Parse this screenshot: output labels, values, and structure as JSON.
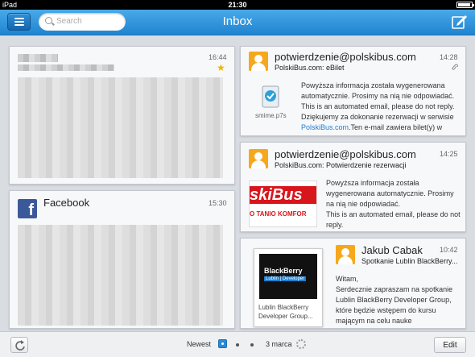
{
  "status_bar": {
    "device": "iPad",
    "time": "21:30"
  },
  "header": {
    "title": "Inbox",
    "search_placeholder": "Search"
  },
  "emails_left": [
    {
      "sender": "",
      "time": "16:44",
      "starred": true
    },
    {
      "sender": "Facebook",
      "time": "15:30"
    }
  ],
  "emails_right": [
    {
      "sender": "potwierdzenie@polskibus.com",
      "subject": "PolskiBus.com: eBilet",
      "time": "14:28",
      "attachment_name": "smime.p7s",
      "body_lines": [
        "Powyższa informacja została wygenerowana",
        "automatycznie. Prosimy na nią nie odpowiadać.",
        "This is an automated email, please do not reply.",
        "Dziękujemy za dokonanie rezerwacji w serwisie"
      ],
      "body_link": "PolskiBus.com",
      "body_tail": ".Ten e-mail zawiera bilet(y) w"
    },
    {
      "sender": "potwierdzenie@polskibus.com",
      "subject": "PolskiBus.com: Potwierdzenie rezerwacji",
      "time": "14:25",
      "logo_text": "skiBus",
      "logo_tagline": "O TANIO KOMFOR",
      "body_lines": [
        "Powyższa informacja została",
        "wygenerowana  automatycznie. Prosimy",
        "na nią nie odpowiadać.",
        "This is an automated email, please do not",
        "reply."
      ]
    },
    {
      "sender": "Jakub Cabak",
      "subject": "Spotkanie Lublin BlackBerry...",
      "time": "10:42",
      "attachment_logo": "BlackBerry",
      "attachment_logo_sub": "Lublin | Developer",
      "attachment_caption_1": "Lublin BlackBerry",
      "attachment_caption_2": "Developer Group...",
      "body_lines": [
        "Witam,",
        "Serdecznie zapraszam na spotkanie",
        "Lublin BlackBerry Developer Group,",
        "które będzie wstępem do kursu",
        "mającym na celu nauke"
      ]
    }
  ],
  "bottom_bar": {
    "newest_label": "Newest",
    "date_label": "3 marca",
    "edit_label": "Edit"
  },
  "colors": {
    "header_blue": "#1f84d0",
    "avatar_orange": "#f5a81c",
    "star_yellow": "#f0b400",
    "link_blue": "#1e7fd0"
  }
}
